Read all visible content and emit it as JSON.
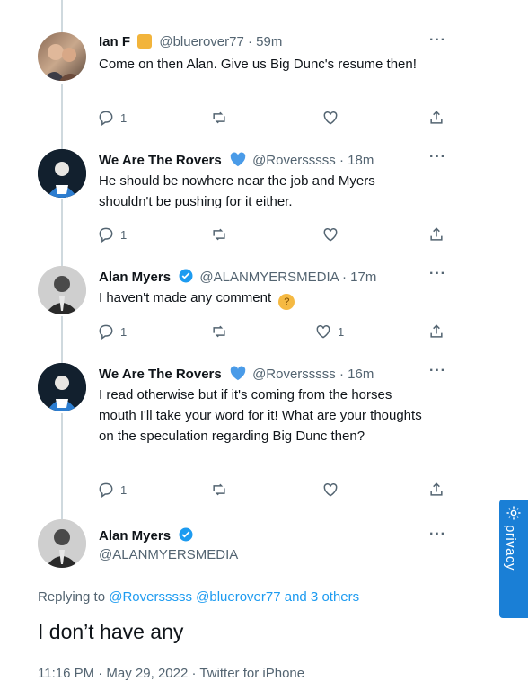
{
  "colors": {
    "accent": "#1d9bf0",
    "muted": "#536471",
    "text": "#0f1419",
    "privacy_bg": "#1a7fd6"
  },
  "tweets": [
    {
      "name": "Ian F",
      "badge": "emoji",
      "handle": "@bluerover77",
      "time": "· 59m",
      "text": "Come on then Alan. Give us Big Dunc's resume then!",
      "reply_count": "1",
      "retweet_count": "",
      "like_count": ""
    },
    {
      "name": "We Are The Rovers",
      "badge": "blue-heart-icon",
      "handle": "@Roversssss",
      "time": "· 18m",
      "text": "He should be nowhere near the job and Myers shouldn't be pushing for it either.",
      "reply_count": "1",
      "retweet_count": "",
      "like_count": ""
    },
    {
      "name": "Alan Myers",
      "badge": "verified-icon",
      "handle": "@ALANMYERSMEDIA",
      "time": "· 17m",
      "text": "I haven't made any comment",
      "reply_count": "1",
      "retweet_count": "",
      "like_count": "1"
    },
    {
      "name": "We Are The Rovers",
      "badge": "blue-heart-icon",
      "handle": "@Roversssss",
      "time": "· 16m",
      "text": "I read otherwise but if it's coming from the horses mouth I'll take your word for it! What are your thoughts on the speculation regarding Big Dunc then?",
      "reply_count": "1",
      "retweet_count": "",
      "like_count": ""
    }
  ],
  "main_tweet": {
    "name": "Alan Myers",
    "handle": "@ALANMYERSMEDIA",
    "replying_prefix": "Replying to",
    "replying_to": "@Roversssss @bluerover77 and 3 others",
    "text": "I don’t have any",
    "meta": "11:16 PM · May 29, 2022 · Twitter for iPhone"
  },
  "more_label": "···",
  "privacy_label": "privacy"
}
